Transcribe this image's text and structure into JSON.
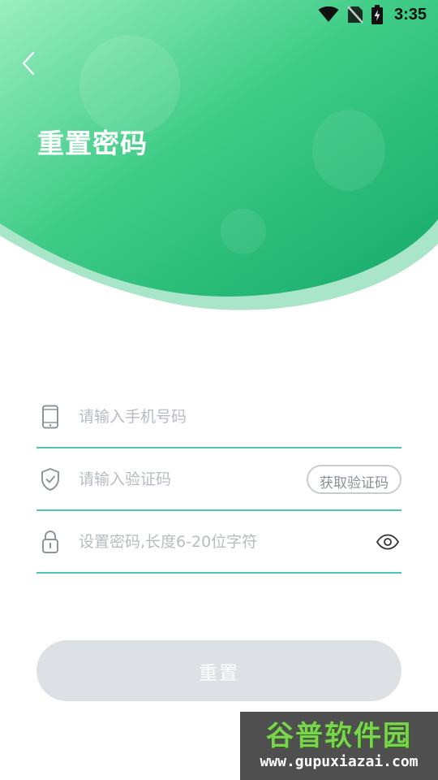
{
  "status_bar": {
    "time": "3:35",
    "icons": [
      "wifi-icon",
      "no-sim-icon",
      "battery-charging-icon"
    ]
  },
  "header": {
    "title": "重置密码",
    "back_icon": "chevron-left-icon",
    "gradient_colors": [
      "#8fe6b5",
      "#2dc47d",
      "#15ab6c"
    ]
  },
  "form": {
    "phone": {
      "icon": "phone-icon",
      "placeholder": "请输入手机号码",
      "value": ""
    },
    "code": {
      "icon": "shield-check-icon",
      "placeholder": "请输入验证码",
      "value": "",
      "get_code_label": "获取验证码"
    },
    "password": {
      "icon": "lock-icon",
      "placeholder": "设置密码,长度6-20位字符",
      "value": "",
      "toggle_icon": "eye-icon"
    },
    "underline_color": "#4fc3b6"
  },
  "submit": {
    "label": "重置",
    "disabled_color": "#dde1e5"
  },
  "watermark": {
    "cn": "谷普软件园",
    "url": "www.gupuxiazai.com"
  }
}
